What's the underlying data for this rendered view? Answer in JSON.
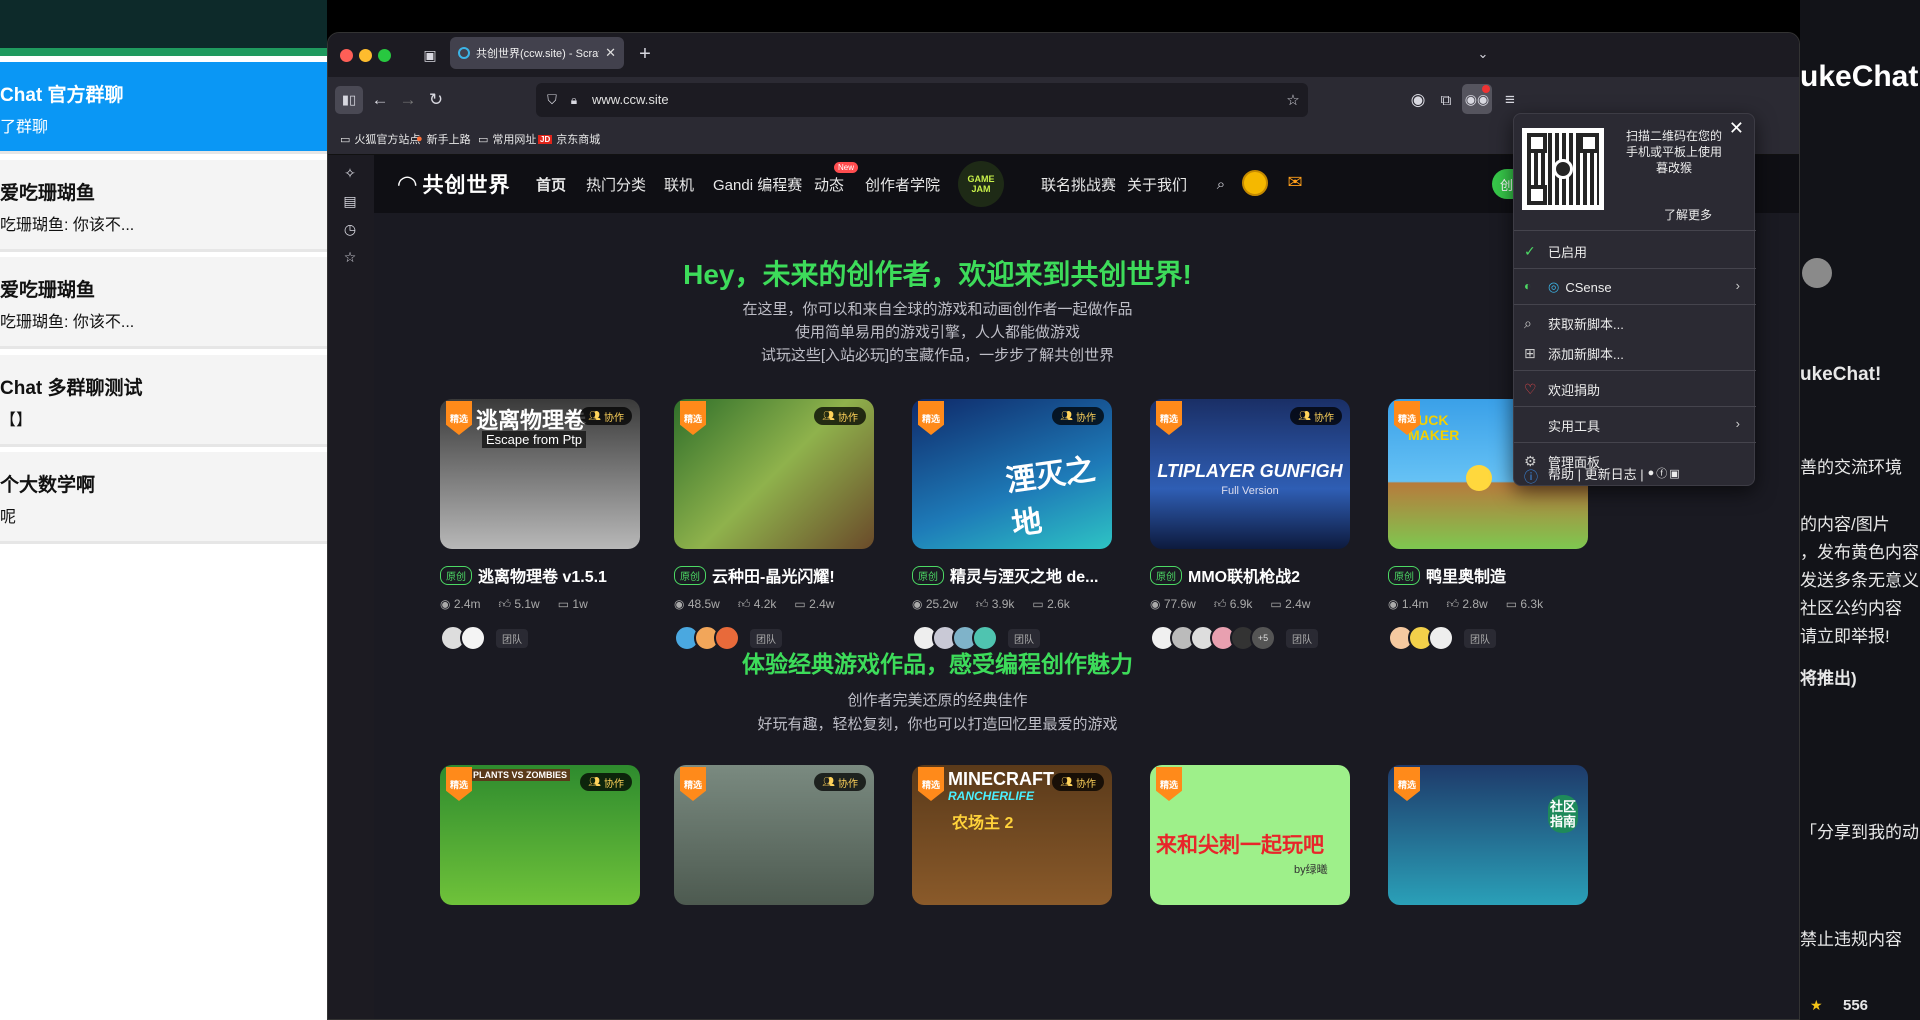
{
  "left_app": {
    "chats": [
      {
        "title": "Chat 官方群聊",
        "sub": "了群聊"
      },
      {
        "title": "爱吃珊瑚鱼",
        "sub": "吃珊瑚鱼: 你该不..."
      },
      {
        "title": "爱吃珊瑚鱼",
        "sub": "吃珊瑚鱼: 你该不..."
      },
      {
        "title": "Chat 多群聊测试",
        "sub": "【】"
      },
      {
        "title": "个大数学啊",
        "sub": "呢"
      }
    ]
  },
  "right_app": {
    "title": "ukeChat",
    "welcome": "ukeChat!",
    "lines": [
      "善的交流环境",
      "的内容/图片",
      "，发布黄色内容",
      "发送多条无意义内",
      "社区公约内容",
      "请立即举报!",
      "将推出)",
      "「分享到我的动",
      "禁止违规内容"
    ],
    "count": "556"
  },
  "browser": {
    "tab_title": "共创世界(ccw.site) - Scratch、图",
    "url": "www.ccw.site",
    "bookmarks": [
      "火狐官方站点",
      "新手上路",
      "常用网址",
      "京东商城"
    ]
  },
  "site": {
    "logo": "共创世界",
    "nav": [
      "首页",
      "热门分类",
      "联机",
      "Gandi 编程赛",
      "动态",
      "创作者学院",
      "联名挑战赛",
      "关于我们"
    ],
    "new_badge": "New",
    "gamejam": "GAME JAM",
    "create_btn": "创作",
    "hero_title": "Hey，未来的创作者，欢迎来到共创世界!",
    "hero_lines": [
      "在这里，你可以和来自全球的游戏和动画创作者一起做作品",
      "使用简单易用的游戏引擎，人人都能做游戏",
      "试玩这些[入站必玩]的宝藏作品，一步步了解共创世界"
    ],
    "section2_title": "体验经典游戏作品，感受编程创作魅力",
    "section2_lines": [
      "创作者完美还原的经典佳作",
      "好玩有趣，轻松复刻，你也可以打造回忆里最爱的游戏"
    ],
    "badge_featured": "精选",
    "badge_coop": "协作",
    "badge_original": "原创",
    "team_label": "团队",
    "cards": [
      {
        "title": "逃离物理卷 v1.5.1",
        "views": "2.4m",
        "likes": "5.1w",
        "comments": "1w",
        "thumb_text": "逃离物理卷",
        "thumb_sub": "Escape from Ptp"
      },
      {
        "title": "云种田-晶光闪耀!",
        "views": "48.5w",
        "likes": "4.2k",
        "comments": "2.4w"
      },
      {
        "title": "精灵与湮灭之地 de...",
        "views": "25.2w",
        "likes": "3.9k",
        "comments": "2.6k",
        "thumb_text": "湮灭之地"
      },
      {
        "title": "MMO联机枪战2",
        "views": "77.6w",
        "likes": "6.9k",
        "comments": "2.4w",
        "thumb_text": "LTIPLAYER GUNFIGH",
        "thumb_sub": "Full Version",
        "extra_avatars": "+5"
      },
      {
        "title": "鸭里奥制造",
        "views": "1.4m",
        "likes": "2.8w",
        "comments": "6.3k",
        "thumb_text": "DUCK MAKER"
      }
    ],
    "cards2": [
      {
        "thumb_text": "PLANTS VS ZOMBIES"
      },
      {
        "thumb_text": ""
      },
      {
        "thumb_text": "MINECRAFT",
        "thumb_sub": "RANCHERLIFE",
        "thumb_line": "农场主 2"
      },
      {
        "thumb_text": "来和尖刺一起玩吧",
        "thumb_sub": "by绿曦"
      },
      {
        "thumb_text": "社区指南"
      }
    ]
  },
  "popup": {
    "qr_text": "扫描二维码在您的手机或平板上使用暮改猴",
    "learn_more": "了解更多",
    "items": [
      "已启用",
      "CSense",
      "获取新脚本...",
      "添加新脚本...",
      "欢迎捐助",
      "实用工具",
      "管理面板",
      "帮助 | 更新日志 |"
    ]
  }
}
